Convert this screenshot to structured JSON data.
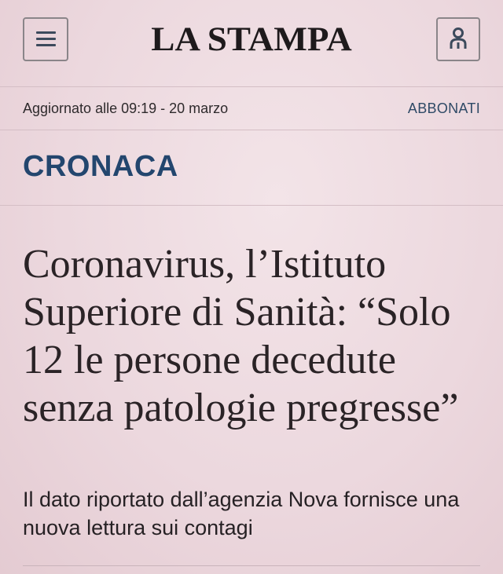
{
  "header": {
    "logo": "LA STAMPA",
    "menu_icon": "hamburger-menu-icon",
    "user_icon": "user-account-icon"
  },
  "subbar": {
    "updated": "Aggiornato alle 09:19 - 20 marzo",
    "subscribe": "ABBONATI"
  },
  "article": {
    "section": "CRONACA",
    "headline": "Coronavirus, l’Istituto Superiore di Sanità: “Solo 12 le persone decedute senza patologie pregresse”",
    "subtitle": "Il dato riportato dall’agenzia Nova fornisce una nuova lettura sui contagi"
  },
  "colors": {
    "background": "#ecd8de",
    "section_blue": "#23466e",
    "subscribe_blue": "#2f4a66",
    "icon_slate": "#3c4a5c"
  }
}
